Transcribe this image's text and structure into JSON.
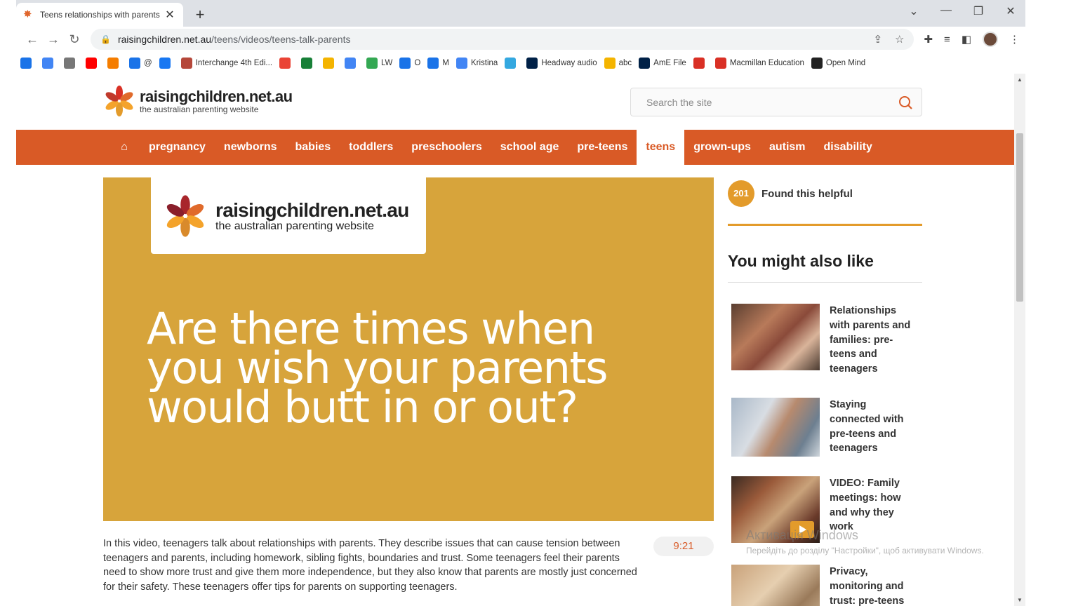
{
  "browser": {
    "tab_title": "Teens relationships with parents",
    "new_tab": "+",
    "url_host": "raisingchildren.net.au",
    "url_path": "/teens/videos/teens-talk-parents",
    "bookmarks": [
      {
        "label": "",
        "icon": "drive-icon",
        "color": "#1a73e8"
      },
      {
        "label": "",
        "icon": "translate-icon",
        "color": "#4285f4"
      },
      {
        "label": "",
        "icon": "globe-icon",
        "color": "#777"
      },
      {
        "label": "",
        "icon": "youtube-icon",
        "color": "#ff0000"
      },
      {
        "label": "",
        "icon": "blogger-icon",
        "color": "#f57d00"
      },
      {
        "label": "@",
        "icon": "info-icon",
        "color": "#1a73e8"
      },
      {
        "label": "",
        "icon": "facebook-icon",
        "color": "#1877f2"
      },
      {
        "label": "Interchange 4th Edi...",
        "icon": "cambridge-icon",
        "color": "#b5473a"
      },
      {
        "label": "",
        "icon": "gmail-icon",
        "color": "#ea4335"
      },
      {
        "label": "",
        "icon": "add-icon",
        "color": "#188038"
      },
      {
        "label": "",
        "icon": "slides-icon",
        "color": "#f4b400"
      },
      {
        "label": "",
        "icon": "docs-icon",
        "color": "#4285f4"
      },
      {
        "label": "LW",
        "icon": "grid-icon",
        "color": "#34a853"
      },
      {
        "label": "O",
        "icon": "drop-icon",
        "color": "#1a73e8"
      },
      {
        "label": "M",
        "icon": "drop-icon",
        "color": "#1a73e8"
      },
      {
        "label": "Kristina",
        "icon": "docs-icon",
        "color": "#4285f4"
      },
      {
        "label": "",
        "icon": "puzzle-icon",
        "color": "#34a8e0"
      },
      {
        "label": "Headway audio",
        "icon": "oxford-icon",
        "color": "#002147"
      },
      {
        "label": "abc",
        "icon": "figure-icon",
        "color": "#f4b400"
      },
      {
        "label": "AmE File",
        "icon": "oxford-icon",
        "color": "#002147"
      },
      {
        "label": "",
        "icon": "heart-icon",
        "color": "#d93025"
      },
      {
        "label": "Macmillan Education",
        "icon": "macmillan-icon",
        "color": "#d93025"
      },
      {
        "label": "Open Mind",
        "icon": "macmillan-icon",
        "color": "#222222"
      }
    ]
  },
  "site": {
    "logo_name": "raisingchildren.net.au",
    "logo_tag": "the australian parenting website",
    "search_placeholder": "Search the site",
    "nav": [
      "pregnancy",
      "newborns",
      "babies",
      "toddlers",
      "preschoolers",
      "school age",
      "pre-teens",
      "teens",
      "grown-ups",
      "autism",
      "disability"
    ],
    "active_nav": "teens"
  },
  "video": {
    "headline": "Are there times when you wish your parents would butt in or out?",
    "duration": "9:21",
    "description": "In this video, teenagers talk about relationships with parents. They describe issues that can cause tension between teenagers and parents, including homework, sibling fights, boundaries and trust. Some teenagers feel their parents need to show more trust and give them more independence, but they also know that parents are mostly just concerned for their safety. These teenagers offer tips for parents on supporting teenagers."
  },
  "sidebar": {
    "helpful_count": "201",
    "helpful_label": "Found this helpful",
    "also_like_title": "You might also like",
    "related": [
      {
        "title": "Relationships with parents and families: pre-teens and teenagers"
      },
      {
        "title": "Staying connected with pre-teens and teenagers"
      },
      {
        "title": "VIDEO: Family meetings: how and why they work"
      },
      {
        "title": "Privacy, monitoring and trust: pre-teens"
      }
    ]
  },
  "os_watermark": {
    "title": "Активація Windows",
    "subtitle": "Перейдіть до розділу \"Настройки\", щоб активувати Windows."
  },
  "colors": {
    "brand_orange": "#d95a26",
    "mustard": "#d7a43b",
    "badge": "#e39b2b"
  }
}
